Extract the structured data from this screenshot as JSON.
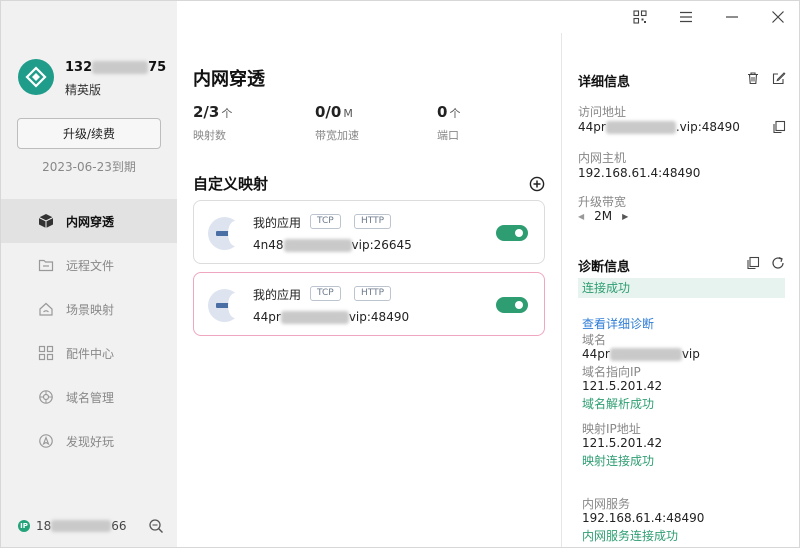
{
  "user": {
    "name_prefix": "132",
    "name_suffix": "75",
    "level": "精英版",
    "upgrade_label": "升级/续费",
    "expire": "2023-06-23到期"
  },
  "nav": {
    "items": [
      {
        "label": "内网穿透",
        "icon": "cube-icon",
        "active": true
      },
      {
        "label": "远程文件",
        "icon": "folder-icon"
      },
      {
        "label": "场景映射",
        "icon": "house-icon"
      },
      {
        "label": "配件中心",
        "icon": "grid-icon"
      },
      {
        "label": "域名管理",
        "icon": "globe-icon"
      },
      {
        "label": "发现好玩",
        "icon": "compass-icon"
      }
    ]
  },
  "bottom": {
    "ip_badge": "IP",
    "ip_prefix": "18",
    "ip_suffix": "66"
  },
  "main": {
    "title": "内网穿透",
    "stats": [
      {
        "value": "2/3",
        "unit": "个",
        "label": "映射数"
      },
      {
        "value": "0/0",
        "unit": "M",
        "label": "带宽加速"
      },
      {
        "value": "0",
        "unit": "个",
        "label": "端口"
      }
    ],
    "section_title": "自定义映射",
    "mappings": [
      {
        "name": "我的应用",
        "tags": [
          "TCP",
          "HTTP"
        ],
        "addr_prefix": "4n48",
        "addr_suffix": "vip:26645",
        "enabled": true,
        "selected": false
      },
      {
        "name": "我的应用",
        "tags": [
          "TCP",
          "HTTP"
        ],
        "addr_prefix": "44pr",
        "addr_suffix": "vip:48490",
        "enabled": true,
        "selected": true
      }
    ]
  },
  "detail": {
    "title": "详细信息",
    "access_label": "访问地址",
    "access_prefix": "44pr",
    "access_suffix": ".vip:48490",
    "host_label": "内网主机",
    "host_value": "192.168.61.4:48490",
    "bandwidth_label": "升级带宽",
    "bandwidth_value": "2M"
  },
  "diagnosis": {
    "title": "诊断信息",
    "status": "连接成功",
    "detail_link": "查看详细诊断",
    "domain_label": "域名",
    "domain_prefix": "44pr",
    "domain_suffix": "vip",
    "ip_label": "域名指向IP",
    "ip_value": "121.5.201.42",
    "ip_status": "域名解析成功",
    "map_ip_label": "映射IP地址",
    "map_ip_value": "121.5.201.42",
    "map_ip_status": "映射连接成功",
    "service_label": "内网服务",
    "service_value": "192.168.61.4:48490",
    "service_status": "内网服务连接成功"
  },
  "colors": {
    "accent_green": "#2e9e72",
    "link_blue": "#2f7dd6",
    "selected_border": "#f0a6c0"
  }
}
